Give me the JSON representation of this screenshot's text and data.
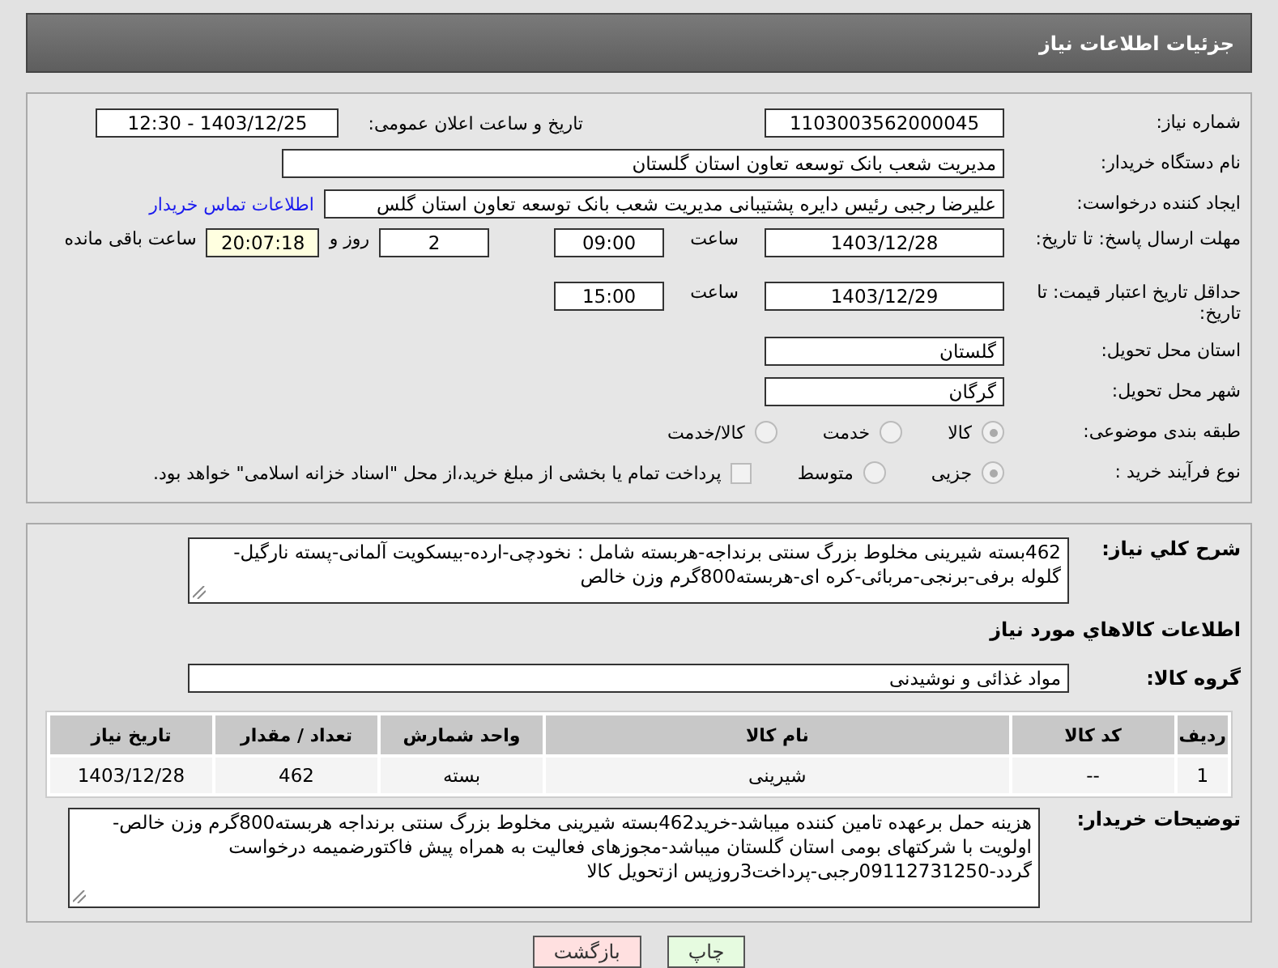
{
  "header": {
    "title": "جزئیات اطلاعات نیاز"
  },
  "details": {
    "need_number": {
      "label": "شماره نیاز:",
      "value": "1103003562000045"
    },
    "announce": {
      "label": "تاریخ و ساعت اعلان عمومی:",
      "value": "1403/12/25 - 12:30"
    },
    "buyer": {
      "label": "نام دستگاه خریدار:",
      "value": "مدیریت شعب بانک توسعه تعاون استان گلستان"
    },
    "creator": {
      "label": "ایجاد کننده درخواست:",
      "value": "علیرضا رجبی رئیس دایره پشتیبانی مدیریت شعب بانک توسعه تعاون استان گلس",
      "link": "اطلاعات تماس خریدار"
    },
    "deadline": {
      "label": "مهلت ارسال پاسخ: تا تاریخ:",
      "date": "1403/12/28",
      "time_label": "ساعت",
      "time": "09:00",
      "days": "2",
      "days_label": "روز و",
      "remaining": "20:07:18",
      "remaining_label": "ساعت باقی مانده"
    },
    "validity": {
      "label": "حداقل تاریخ اعتبار قیمت: تا تاریخ:",
      "date": "1403/12/29",
      "time_label": "ساعت",
      "time": "15:00"
    },
    "province": {
      "label": "استان محل تحویل:",
      "value": "گلستان"
    },
    "city": {
      "label": "شهر محل تحویل:",
      "value": "گرگان"
    },
    "category": {
      "label": "طبقه بندی موضوعی:",
      "options": [
        {
          "label": "کالا",
          "selected": true
        },
        {
          "label": "خدمت",
          "selected": false
        },
        {
          "label": "کالا/خدمت",
          "selected": false
        }
      ]
    },
    "process": {
      "label": "نوع فرآیند خرید :",
      "options": [
        {
          "label": "جزیی",
          "selected": true
        },
        {
          "label": "متوسط",
          "selected": false
        }
      ],
      "treasury": {
        "label": "پرداخت تمام یا بخشی از مبلغ خرید،از محل \"اسناد خزانه اسلامی\" خواهد بود.",
        "checked": false
      }
    }
  },
  "goods": {
    "summary": {
      "label": "شرح کلي نیاز:",
      "value": "462بسته شیرینی مخلوط بزرگ سنتی برنداجه-هربسته شامل : نخودچی-ارده-بیسکویت آلمانی-پسته نارگیل-گلوله برفی-برنجی-مربائی-کره ای-هربسته800گرم وزن خالص"
    },
    "heading": "اطلاعات کالاهاي مورد نیاز",
    "group": {
      "label": "گروه کالا:",
      "value": "مواد غذائی و نوشیدنی"
    },
    "table": {
      "columns": [
        "ردیف",
        "کد کالا",
        "نام کالا",
        "واحد شمارش",
        "تعداد / مقدار",
        "تاریخ نیاز"
      ],
      "rows": [
        [
          "1",
          "--",
          "شیرینی",
          "بسته",
          "462",
          "1403/12/28"
        ]
      ]
    },
    "notes": {
      "label": "توضیحات خریدار:",
      "value": "هزینه حمل برعهده تامین کننده میباشد-خرید462بسته شیرینی مخلوط بزرگ سنتی برنداجه هربسته800گرم وزن خالص-اولویت با شرکتهای بومی استان گلستان میباشد-مجوزهای فعالیت به همراه پیش فاکتورضمیمه درخواست گردد-09112731250رجبی-پرداخت3روزپس ازتحویل کالا"
    }
  },
  "buttons": [
    {
      "label": "چاپ",
      "kind": "print"
    },
    {
      "label": "بازگشت",
      "kind": "back"
    }
  ]
}
